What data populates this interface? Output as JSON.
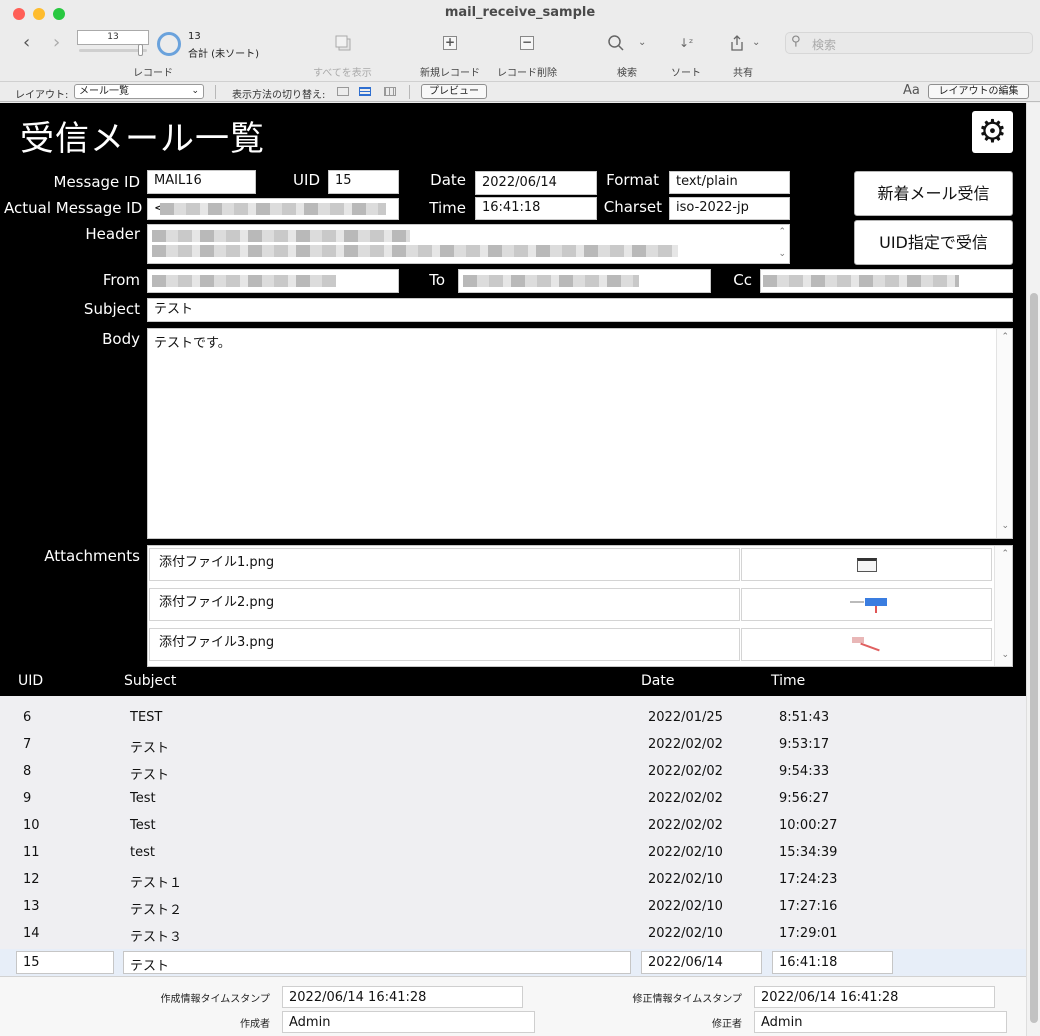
{
  "window": {
    "title": "mail_receive_sample",
    "traffic_lights": {
      "close": "#ff5f57",
      "minimize": "#febc2e",
      "zoom": "#28c840"
    }
  },
  "toolbar": {
    "back_icon": "chevron-left-icon",
    "forward_icon": "chevron-right-icon",
    "record_input": "13",
    "record_count": "13",
    "record_total": "合計 (未ソート)",
    "records_label": "レコード",
    "show_all_label": "すべてを表示",
    "new_record_label": "新規レコード",
    "delete_record_label": "レコード削除",
    "find_label": "検索",
    "sort_label": "ソート",
    "share_label": "共有",
    "search_placeholder": "検索"
  },
  "layout_bar": {
    "layout_label": "レイアウト:",
    "layout_value": "メール一覧",
    "view_as_label": "表示方法の切り替え:",
    "preview_button": "プレビュー",
    "font_icon": "Aa",
    "edit_layout_button": "レイアウトの編集"
  },
  "page": {
    "title": "受信メール一覧",
    "settings_icon": "gear-icon"
  },
  "record": {
    "message_id_label": "Message ID",
    "message_id": "MAIL16",
    "uid_label": "UID",
    "uid": "15",
    "date_label": "Date",
    "date": "2022/06/14",
    "format_label": "Format",
    "format": "text/plain",
    "actual_message_id_label": "Actual Message ID",
    "actual_message_id_prefix": "<",
    "time_label": "Time",
    "time": "16:41:18",
    "charset_label": "Charset",
    "charset": "iso-2022-jp",
    "header_label": "Header",
    "from_label": "From",
    "to_label": "To",
    "cc_label": "Cc",
    "subject_label": "Subject",
    "subject": "テスト",
    "body_label": "Body",
    "body": "テストです。",
    "attachments_label": "Attachments",
    "attachments": [
      {
        "name": "添付ファイル1.png"
      },
      {
        "name": "添付ファイル2.png"
      },
      {
        "name": "添付ファイル3.png"
      }
    ]
  },
  "buttons": {
    "receive_new": "新着メール受信",
    "receive_by_uid": "UID指定で受信"
  },
  "list": {
    "headers": {
      "uid": "UID",
      "subject": "Subject",
      "date": "Date",
      "time": "Time"
    },
    "rows": [
      {
        "uid": "6",
        "subject": "TEST",
        "date": "2022/01/25",
        "time": "8:51:43"
      },
      {
        "uid": "7",
        "subject": "テスト",
        "date": "2022/02/02",
        "time": "9:53:17"
      },
      {
        "uid": "8",
        "subject": "テスト",
        "date": "2022/02/02",
        "time": "9:54:33"
      },
      {
        "uid": "9",
        "subject": "Test",
        "date": "2022/02/02",
        "time": "9:56:27"
      },
      {
        "uid": "10",
        "subject": "Test",
        "date": "2022/02/02",
        "time": "10:00:27"
      },
      {
        "uid": "11",
        "subject": "test",
        "date": "2022/02/10",
        "time": "15:34:39"
      },
      {
        "uid": "12",
        "subject": "テスト１",
        "date": "2022/02/10",
        "time": "17:24:23"
      },
      {
        "uid": "13",
        "subject": "テスト２",
        "date": "2022/02/10",
        "time": "17:27:16"
      },
      {
        "uid": "14",
        "subject": "テスト３",
        "date": "2022/02/10",
        "time": "17:29:01"
      }
    ],
    "current_row": {
      "uid": "15",
      "subject": "テスト",
      "date": "2022/06/14",
      "time": "16:41:18"
    }
  },
  "footer": {
    "created_ts_label": "作成情報タイムスタンプ",
    "created_ts": "2022/06/14 16:41:28",
    "creator_label": "作成者",
    "creator": "Admin",
    "modified_ts_label": "修正情報タイムスタンプ",
    "modified_ts": "2022/06/14 16:41:28",
    "modifier_label": "修正者",
    "modifier": "Admin"
  }
}
